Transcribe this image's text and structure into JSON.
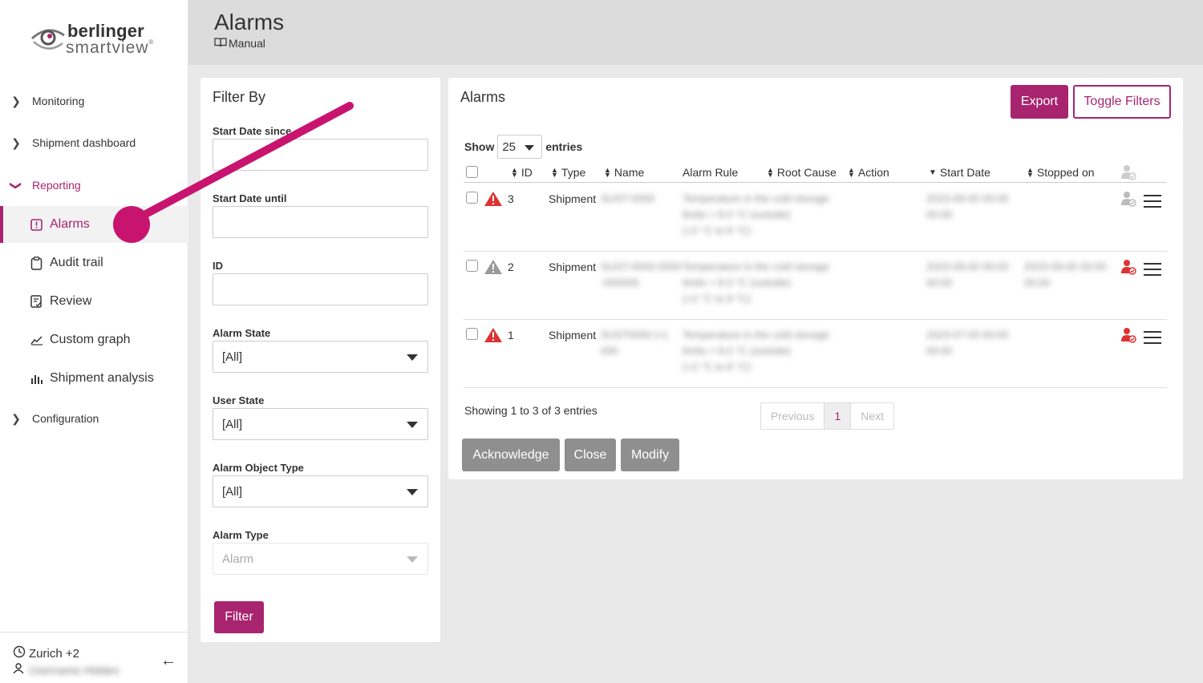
{
  "brand": {
    "name": "berlinger",
    "product": "smartview",
    "reg": "®"
  },
  "header": {
    "title": "Alarms",
    "manual_label": "Manual"
  },
  "nav": {
    "monitoring": "Monitoring",
    "shipment_dashboard": "Shipment dashboard",
    "reporting": "Reporting",
    "alarms": "Alarms",
    "audit_trail": "Audit trail",
    "review": "Review",
    "custom_graph": "Custom graph",
    "shipment_analysis": "Shipment analysis",
    "configuration": "Configuration"
  },
  "footer": {
    "timezone": "Zurich +2",
    "user": "Username Hidden"
  },
  "filter": {
    "title": "Filter By",
    "start_since": "Start Date since",
    "start_until": "Start Date until",
    "id": "ID",
    "alarm_state": "Alarm State",
    "alarm_state_value": "[All]",
    "user_state": "User State",
    "user_state_value": "[All]",
    "object_type": "Alarm Object Type",
    "object_type_value": "[All]",
    "alarm_type": "Alarm Type",
    "alarm_type_value": "Alarm",
    "button": "Filter"
  },
  "alarms": {
    "title": "Alarms",
    "export": "Export",
    "toggle_filters": "Toggle Filters",
    "show": "Show",
    "page_length": "25",
    "entries": "entries",
    "columns": {
      "id": "ID",
      "type": "Type",
      "name": "Name",
      "alarm_rule": "Alarm Rule",
      "root_cause": "Root Cause",
      "action": "Action",
      "start_date": "Start Date",
      "stopped_on": "Stopped on"
    },
    "rows": [
      {
        "id": "3",
        "type": "Shipment",
        "name": "SUST-0000",
        "rule1": "Temperature in the cold storage",
        "rule2": "limits > 8.0 °C (outside)",
        "rule3": "(+2 °C to 8 °C)",
        "start1": "2023-09-00 00:00",
        "start2": "00:00",
        "stop1": "",
        "stop2": "",
        "icon_color": "#d33",
        "user_color": "#bbb"
      },
      {
        "id": "2",
        "type": "Shipment",
        "name": "SUST-0000-0000",
        "name2": "-000000",
        "rule1": "Temperature in the cold storage",
        "rule2": "limits > 8.0 °C (outside)",
        "rule3": "(+2 °C to 8 °C)",
        "start1": "2023-09-00 00:00",
        "start2": "00:00",
        "stop1": "2023-09-00 00:00",
        "stop2": "00:00",
        "icon_color": "#999",
        "user_color": "#d33"
      },
      {
        "id": "1",
        "type": "Shipment",
        "name": "SUST0000 (+)",
        "name2": "000",
        "rule1": "Temperature in the cold storage",
        "rule2": "limits > 8.0 °C (outside)",
        "rule3": "(+2 °C to 8 °C)",
        "start1": "2023-07-00 00:00",
        "start2": "00:00",
        "stop1": "",
        "stop2": "",
        "icon_color": "#d33",
        "user_color": "#d33"
      }
    ],
    "info": "Showing 1 to 3 of 3 entries",
    "pager": {
      "previous": "Previous",
      "current": "1",
      "next": "Next"
    },
    "actions": {
      "acknowledge": "Acknowledge",
      "close": "Close",
      "modify": "Modify"
    }
  },
  "colors": {
    "accent": "#a8246f",
    "warning_red": "#d33",
    "warning_gray": "#999",
    "disabled_button": "#8f8f8f"
  },
  "icons": [
    "chevron-right-icon",
    "chevron-down-icon",
    "alarm-icon",
    "clipboard-icon",
    "review-icon",
    "graph-icon",
    "bar-chart-icon",
    "clock-icon",
    "user-icon",
    "arrow-left-icon",
    "book-icon",
    "warning-icon",
    "user-check-icon",
    "menu-icon"
  ]
}
